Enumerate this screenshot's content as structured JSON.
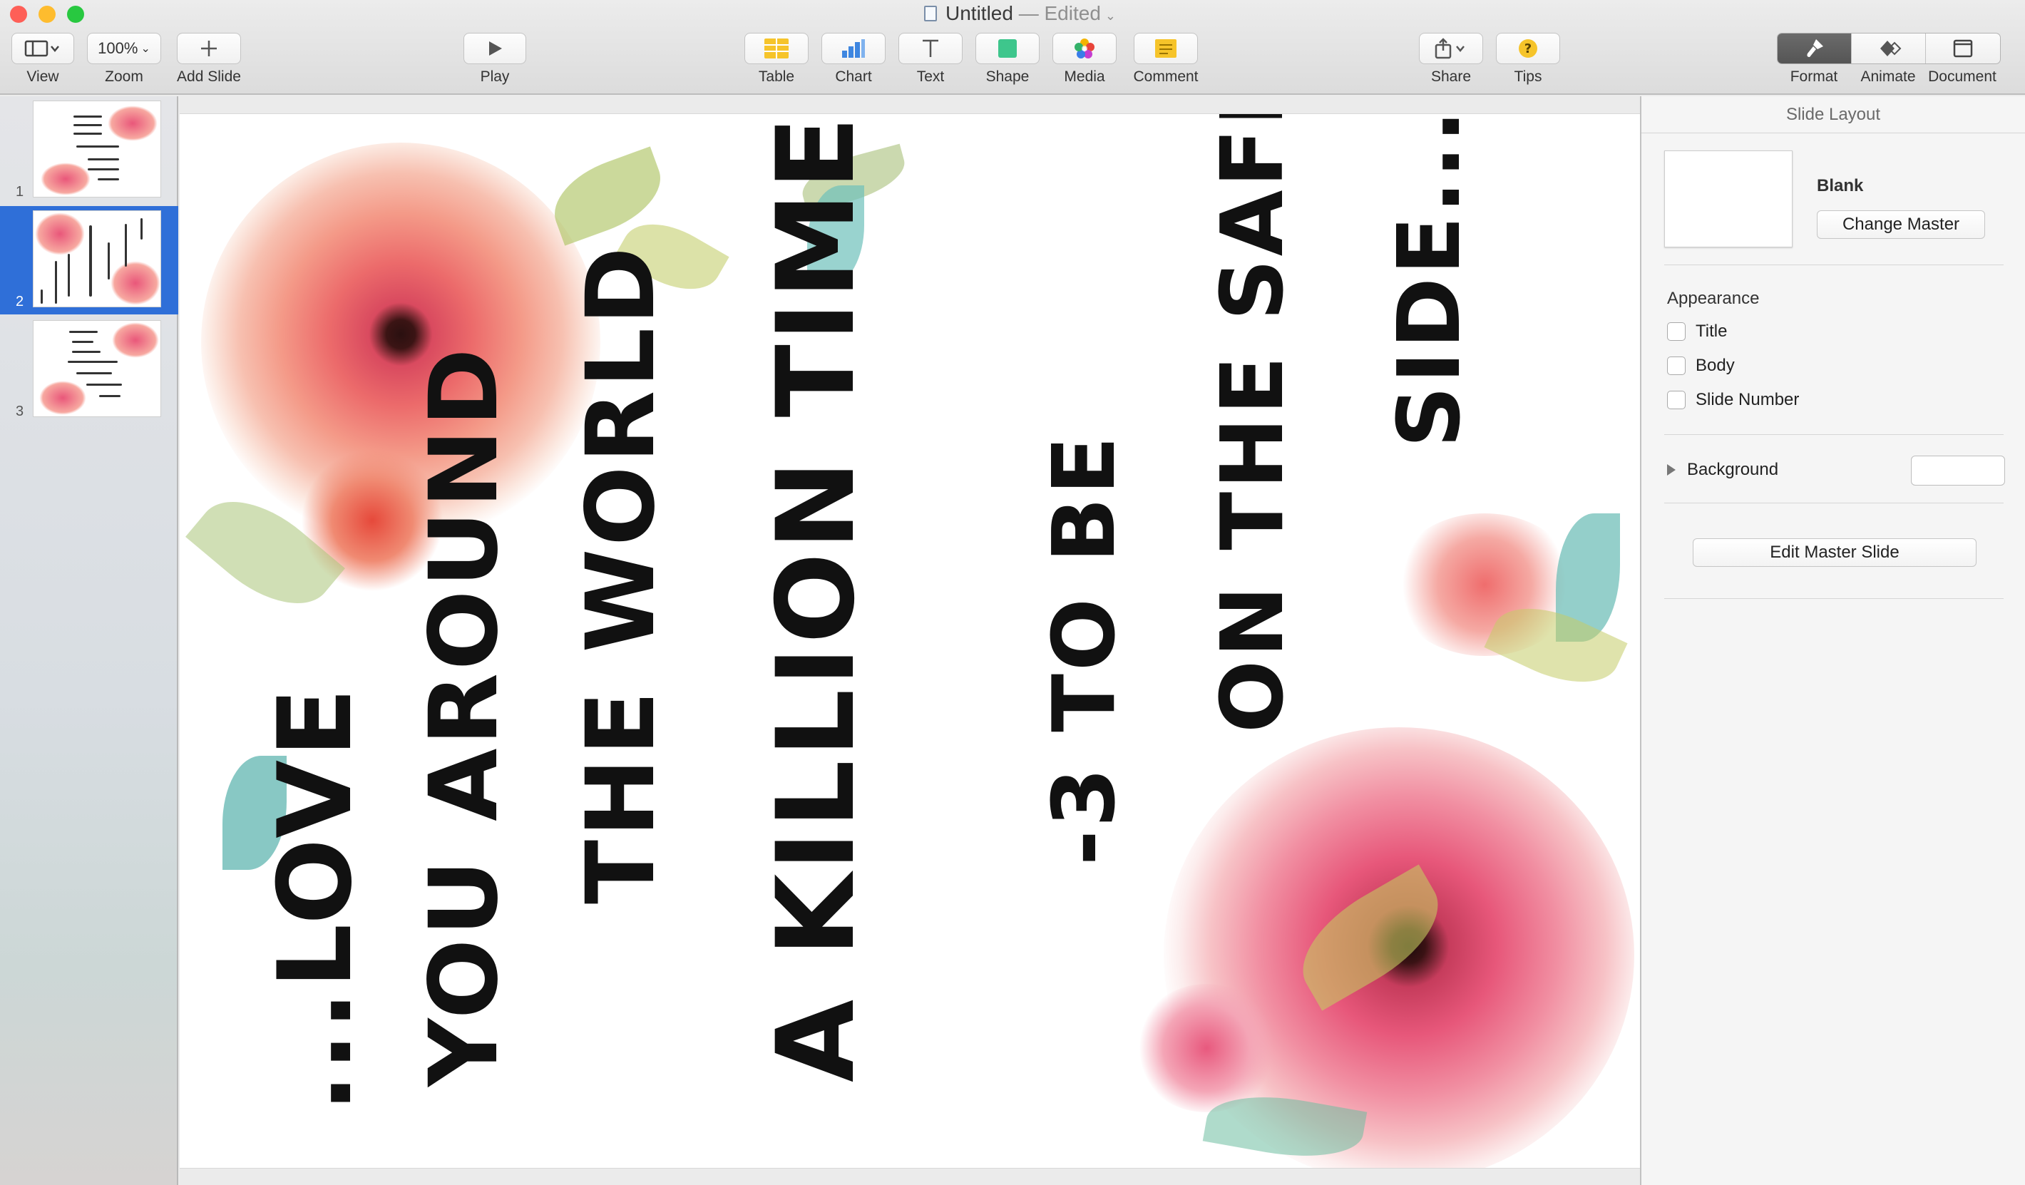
{
  "window": {
    "title": "Untitled",
    "edited": "— Edited",
    "colors": {
      "close": "#fe5f57",
      "minimize": "#febc2e",
      "zoom": "#28c840"
    }
  },
  "toolbar": {
    "view_label": "View",
    "zoom_value": "100%",
    "zoom_label": "Zoom",
    "add_slide_label": "Add Slide",
    "play_label": "Play",
    "table_label": "Table",
    "chart_label": "Chart",
    "text_label": "Text",
    "shape_label": "Shape",
    "media_label": "Media",
    "comment_label": "Comment",
    "share_label": "Share",
    "tips_label": "Tips",
    "format_label": "Format",
    "animate_label": "Animate",
    "document_label": "Document"
  },
  "navigator": {
    "slides": [
      {
        "number": "1"
      },
      {
        "number": "2",
        "selected": true
      },
      {
        "number": "3"
      }
    ],
    "selected_color": "#2f6fd8"
  },
  "slide": {
    "lines": [
      "...LOVE",
      "YOU AROUND",
      "THE WORLD",
      "A KILLION TIMES",
      "-3 TO BE",
      "ON THE SAFE",
      "SIDE..."
    ]
  },
  "inspector": {
    "header": "Slide Layout",
    "master_name": "Blank",
    "change_master_label": "Change Master",
    "appearance_label": "Appearance",
    "title_label": "Title",
    "body_label": "Body",
    "slide_number_label": "Slide Number",
    "background_label": "Background",
    "edit_master_label": "Edit Master Slide"
  }
}
